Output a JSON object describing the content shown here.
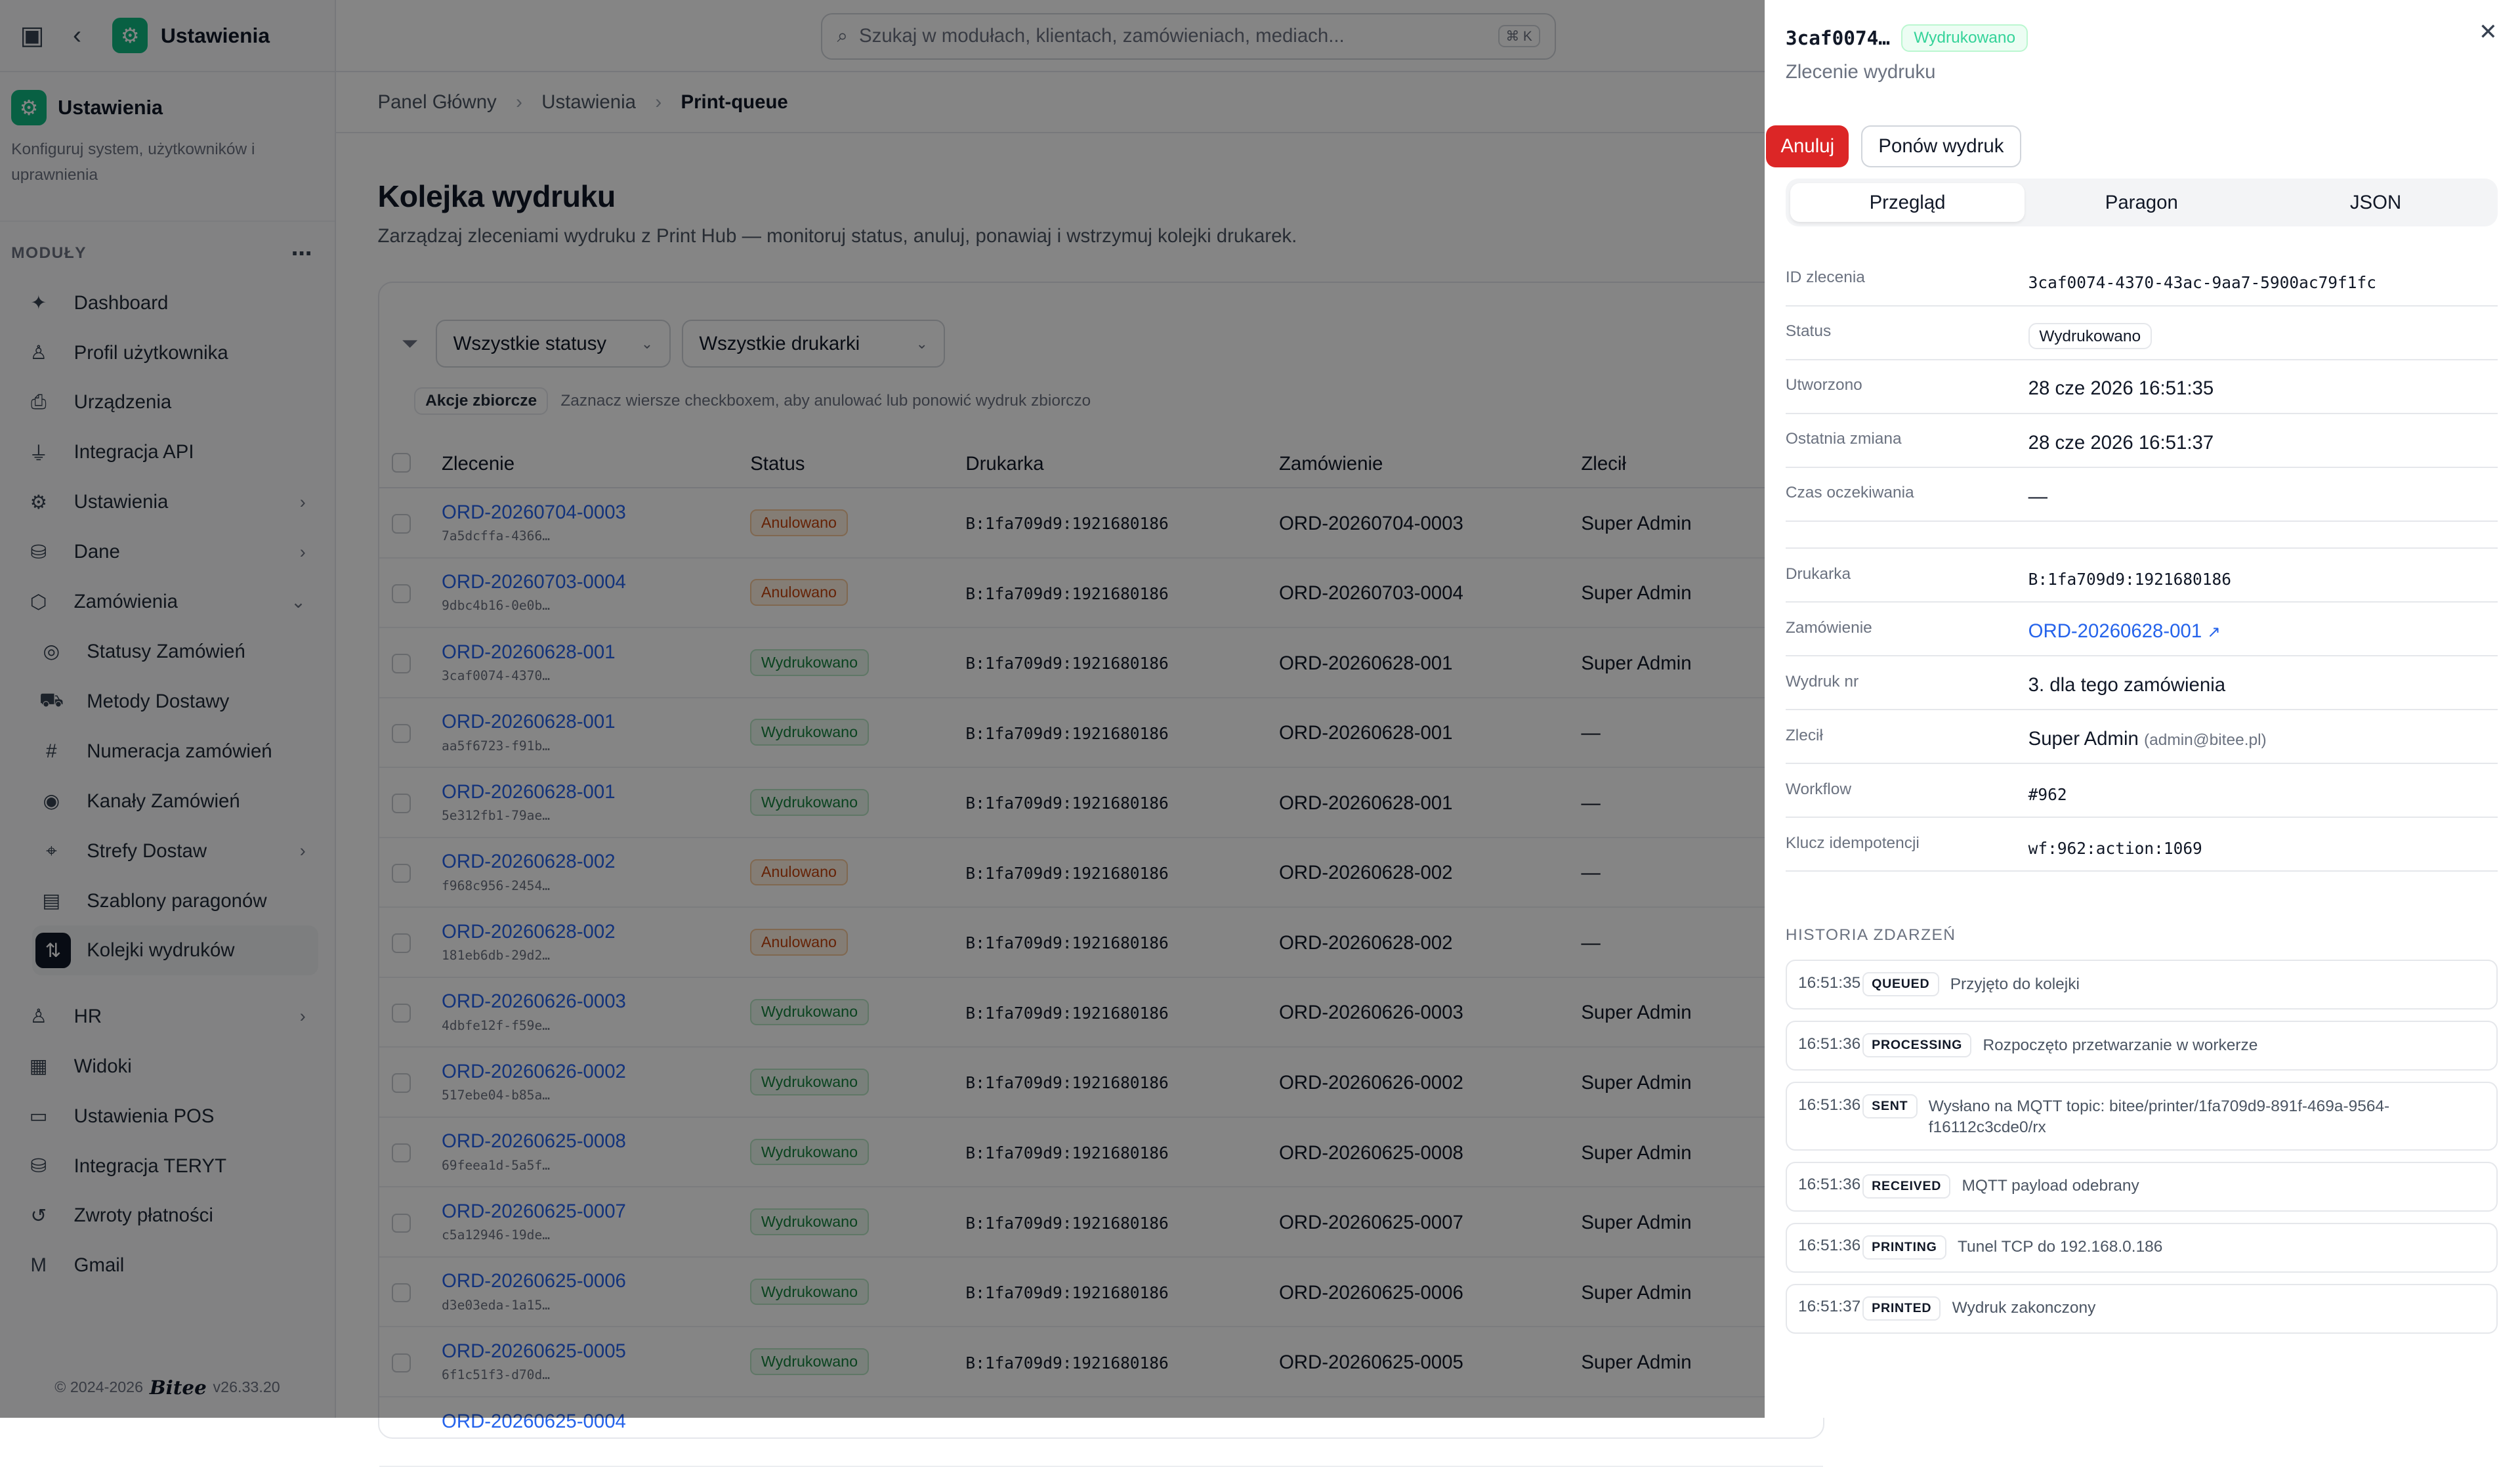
{
  "app": {
    "title": "Ustawienia"
  },
  "context": {
    "title": "Ustawienia",
    "description": "Konfiguruj system, użytkowników i uprawnienia"
  },
  "modules_label": "MODUŁY",
  "nav": [
    {
      "label": "Dashboard",
      "icon": "sparkle-icon",
      "glyph": "✦"
    },
    {
      "label": "Profil użytkownika",
      "icon": "user-icon",
      "glyph": "♙"
    },
    {
      "label": "Urządzenia",
      "icon": "printer-icon",
      "glyph": "⎙"
    },
    {
      "label": "Integracja API",
      "icon": "plug-icon",
      "glyph": "⏚"
    },
    {
      "label": "Ustawienia",
      "icon": "gear-icon",
      "glyph": "⚙",
      "chev": "›"
    },
    {
      "label": "Dane",
      "icon": "database-icon",
      "glyph": "⛁",
      "chev": "›"
    },
    {
      "label": "Zamówienia",
      "icon": "box-icon",
      "glyph": "⬡",
      "chev": "⌄"
    }
  ],
  "subnav": [
    {
      "label": "Statusy Zamówień",
      "icon": "check-circle-icon",
      "glyph": "◎"
    },
    {
      "label": "Metody Dostawy",
      "icon": "truck-icon",
      "glyph": "⛟"
    },
    {
      "label": "Numeracja zamówień",
      "icon": "hash-icon",
      "glyph": "#"
    },
    {
      "label": "Kanały Zamówień",
      "icon": "radio-icon",
      "glyph": "◉"
    },
    {
      "label": "Strefy Dostaw",
      "icon": "map-pin-icon",
      "glyph": "⌖",
      "chev": "›"
    },
    {
      "label": "Szablony paragonów",
      "icon": "receipt-icon",
      "glyph": "▤"
    },
    {
      "label": "Kolejki wydruków",
      "icon": "arrows-updown-icon",
      "glyph": "⇅",
      "active": true
    }
  ],
  "nav2": [
    {
      "label": "HR",
      "icon": "user-icon",
      "glyph": "♙",
      "chev": "›"
    },
    {
      "label": "Widoki",
      "icon": "table-icon",
      "glyph": "▦"
    },
    {
      "label": "Ustawienia POS",
      "icon": "monitor-icon",
      "glyph": "▭"
    },
    {
      "label": "Integracja TERYT",
      "icon": "database-icon",
      "glyph": "⛁"
    },
    {
      "label": "Zwroty płatności",
      "icon": "refresh-icon",
      "glyph": "↺"
    },
    {
      "label": "Gmail",
      "icon": "gmail-icon",
      "glyph": "M"
    }
  ],
  "footer": {
    "copyright": "© 2024-2026",
    "brand": "Bitee",
    "version": "v26.33.20"
  },
  "search": {
    "placeholder": "Szukaj w modułach, klientach, zamówieniach, mediach...",
    "shortcut": "⌘ K"
  },
  "breadcrumb": [
    "Panel Główny",
    "Ustawienia",
    "Print-queue"
  ],
  "page": {
    "title": "Kolejka wydruku",
    "subtitle": "Zarządzaj zleceniami wydruku z Print Hub — monitoruj status, anuluj, ponawiaj i wstrzymuj kolejki drukarek."
  },
  "filters": {
    "status": "Wszystkie statusy",
    "printer": "Wszystkie drukarki"
  },
  "bulk": {
    "tag": "Akcje zbiorcze",
    "hint": "Zaznacz wiersze checkboxem, aby anulować lub ponowić wydruk zbiorczo"
  },
  "table": {
    "headers": [
      "Zlecenie",
      "Status",
      "Drukarka",
      "Zamówienie",
      "Zlecił"
    ],
    "rows": [
      {
        "id": "ORD-20260704-0003",
        "hash": "7a5dcffa-4366…",
        "status": "Anulowano",
        "kind": "cancel",
        "printer": "B:1fa709d9:1921680186",
        "order": "ORD-20260704-0003",
        "who": "Super Admin"
      },
      {
        "id": "ORD-20260703-0004",
        "hash": "9dbc4b16-0e0b…",
        "status": "Anulowano",
        "kind": "cancel",
        "printer": "B:1fa709d9:1921680186",
        "order": "ORD-20260703-0004",
        "who": "Super Admin"
      },
      {
        "id": "ORD-20260628-001",
        "hash": "3caf0074-4370…",
        "status": "Wydrukowano",
        "kind": "done",
        "printer": "B:1fa709d9:1921680186",
        "order": "ORD-20260628-001",
        "who": "Super Admin"
      },
      {
        "id": "ORD-20260628-001",
        "hash": "aa5f6723-f91b…",
        "status": "Wydrukowano",
        "kind": "done",
        "printer": "B:1fa709d9:1921680186",
        "order": "ORD-20260628-001",
        "who": "—"
      },
      {
        "id": "ORD-20260628-001",
        "hash": "5e312fb1-79ae…",
        "status": "Wydrukowano",
        "kind": "done",
        "printer": "B:1fa709d9:1921680186",
        "order": "ORD-20260628-001",
        "who": "—"
      },
      {
        "id": "ORD-20260628-002",
        "hash": "f968c956-2454…",
        "status": "Anulowano",
        "kind": "cancel",
        "printer": "B:1fa709d9:1921680186",
        "order": "ORD-20260628-002",
        "who": "—"
      },
      {
        "id": "ORD-20260628-002",
        "hash": "181eb6db-29d2…",
        "status": "Anulowano",
        "kind": "cancel",
        "printer": "B:1fa709d9:1921680186",
        "order": "ORD-20260628-002",
        "who": "—"
      },
      {
        "id": "ORD-20260626-0003",
        "hash": "4dbfe12f-f59e…",
        "status": "Wydrukowano",
        "kind": "done",
        "printer": "B:1fa709d9:1921680186",
        "order": "ORD-20260626-0003",
        "who": "Super Admin"
      },
      {
        "id": "ORD-20260626-0002",
        "hash": "517ebe04-b85a…",
        "status": "Wydrukowano",
        "kind": "done",
        "printer": "B:1fa709d9:1921680186",
        "order": "ORD-20260626-0002",
        "who": "Super Admin"
      },
      {
        "id": "ORD-20260625-0008",
        "hash": "69feea1d-5a5f…",
        "status": "Wydrukowano",
        "kind": "done",
        "printer": "B:1fa709d9:1921680186",
        "order": "ORD-20260625-0008",
        "who": "Super Admin"
      },
      {
        "id": "ORD-20260625-0007",
        "hash": "c5a12946-19de…",
        "status": "Wydrukowano",
        "kind": "done",
        "printer": "B:1fa709d9:1921680186",
        "order": "ORD-20260625-0007",
        "who": "Super Admin"
      },
      {
        "id": "ORD-20260625-0006",
        "hash": "d3e03eda-1a15…",
        "status": "Wydrukowano",
        "kind": "done",
        "printer": "B:1fa709d9:1921680186",
        "order": "ORD-20260625-0006",
        "who": "Super Admin"
      },
      {
        "id": "ORD-20260625-0005",
        "hash": "6f1c51f3-d70d…",
        "status": "Wydrukowano",
        "kind": "done",
        "printer": "B:1fa709d9:1921680186",
        "order": "ORD-20260625-0005",
        "who": "Super Admin"
      }
    ],
    "partial_row_id": "ORD-20260625-0004"
  },
  "drawer": {
    "short_id": "3caf0074…",
    "status_badge": "Wydrukowano",
    "subtitle": "Zlecenie wydruku",
    "cancel_label": "Anuluj",
    "retry_label": "Ponów wydruk",
    "tabs": [
      "Przegląd",
      "Paragon",
      "JSON"
    ],
    "fields1": [
      {
        "label": "ID zlecenia",
        "value": "3caf0074-4370-43ac-9aa7-5900ac79f1fc",
        "mono": true
      },
      {
        "label": "Status",
        "value": "Wydrukowano",
        "chip": true
      },
      {
        "label": "Utworzono",
        "value": "28 cze 2026 16:51:35"
      },
      {
        "label": "Ostatnia zmiana",
        "value": "28 cze 2026 16:51:37"
      },
      {
        "label": "Czas oczekiwania",
        "value": "—"
      }
    ],
    "fields2": [
      {
        "label": "Drukarka",
        "value": "B:1fa709d9:1921680186",
        "mono": true
      },
      {
        "label": "Zamówienie",
        "value": "ORD-20260628-001",
        "link": true,
        "icon": "external-link-icon"
      },
      {
        "label": "Wydruk nr",
        "value": "3. dla tego zamówienia"
      },
      {
        "label": "Zlecił",
        "value": "Super Admin",
        "extra": "(admin@bitee.pl)"
      },
      {
        "label": "Workflow",
        "value": "#962",
        "mono": true
      },
      {
        "label": "Klucz idempotencji",
        "value": "wf:962:action:1069",
        "mono": true
      }
    ],
    "history_title": "HISTORIA ZDARZEŃ",
    "events": [
      {
        "time": "16:51:35",
        "kind": "QUEUED",
        "msg": "Przyjęto do kolejki"
      },
      {
        "time": "16:51:36",
        "kind": "PROCESSING",
        "msg": "Rozpoczęto przetwarzanie w workerze"
      },
      {
        "time": "16:51:36",
        "kind": "SENT",
        "msg": "Wysłano na MQTT topic: bitee/printer/1fa709d9-891f-469a-9564-f16112c3cde0/rx"
      },
      {
        "time": "16:51:36",
        "kind": "RECEIVED",
        "msg": "MQTT payload odebrany"
      },
      {
        "time": "16:51:36",
        "kind": "PRINTING",
        "msg": "Tunel TCP do 192.168.0.186"
      },
      {
        "time": "16:51:37",
        "kind": "PRINTED",
        "msg": "Wydruk zakonczony"
      }
    ]
  }
}
